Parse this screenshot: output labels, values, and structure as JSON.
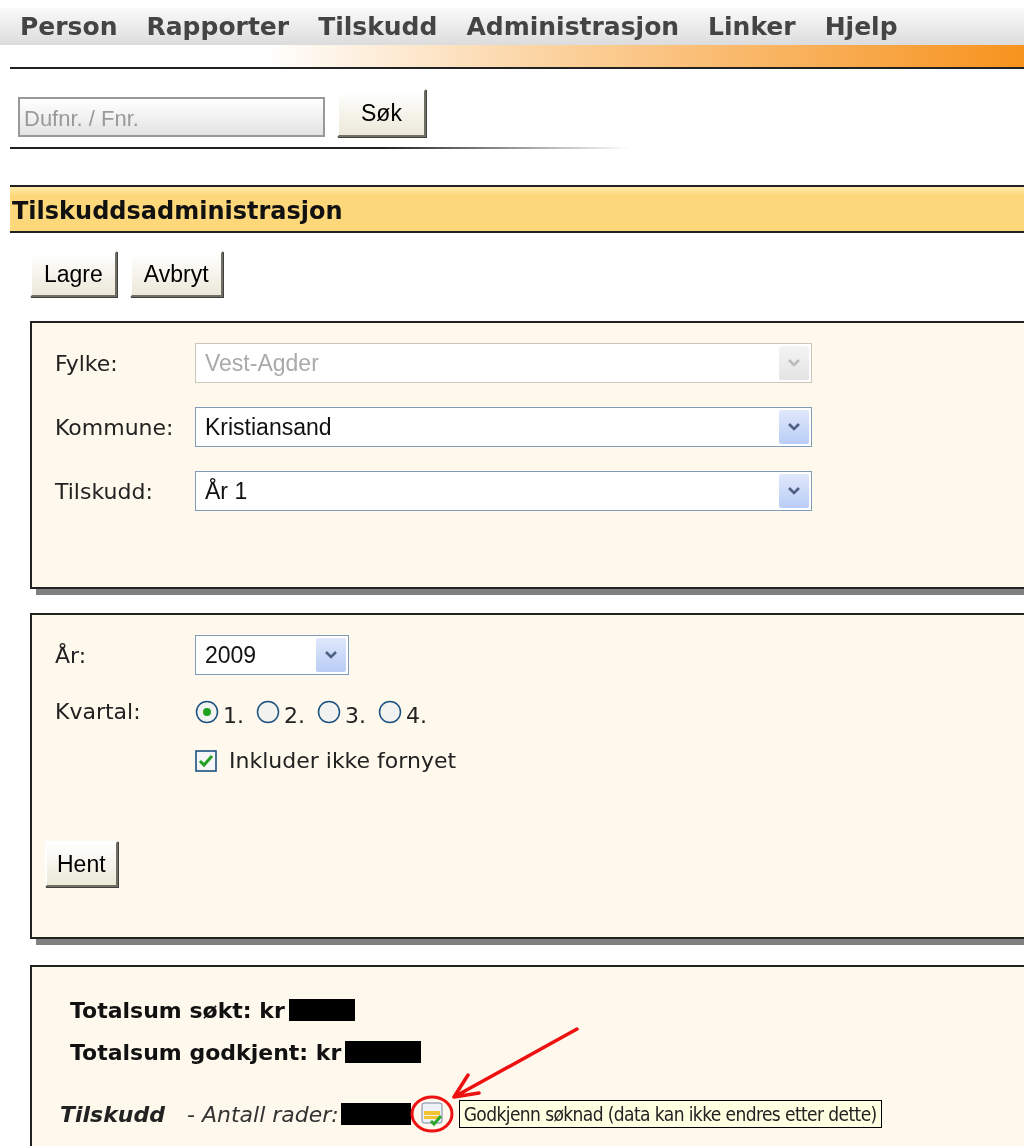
{
  "menu": [
    {
      "label": "Person"
    },
    {
      "label": "Rapporter"
    },
    {
      "label": "Tilskudd"
    },
    {
      "label": "Administrasjon"
    },
    {
      "label": "Linker"
    },
    {
      "label": "Hjelp"
    }
  ],
  "search": {
    "placeholder": "Dufnr. / Fnr.",
    "button": "Søk"
  },
  "section_title": "Tilskuddsadministrasjon",
  "actions": [
    "Lagre",
    "Avbryt"
  ],
  "selection": {
    "fields": [
      {
        "label": "Fylke:",
        "value": "Vest-Agder",
        "disabled": true
      },
      {
        "label": "Kommune:",
        "value": "Kristiansand",
        "disabled": false
      },
      {
        "label": "Tilskudd:",
        "value": "År 1",
        "disabled": false
      }
    ]
  },
  "period": {
    "year": {
      "label": "År:",
      "value": "2009"
    },
    "quarter": {
      "label": "Kvartal:",
      "options": [
        {
          "label": "1.",
          "selected": true
        },
        {
          "label": "2.",
          "selected": false
        },
        {
          "label": "3.",
          "selected": false
        },
        {
          "label": "4.",
          "selected": false
        }
      ]
    },
    "include_not_renewed": {
      "label": "Inkluder ikke fornyet",
      "checked": true
    },
    "fetch_button": "Hent"
  },
  "results": {
    "totals": [
      {
        "label": "Totalsum søkt: kr"
      },
      {
        "label": "Totalsum godkjent: kr"
      }
    ],
    "list_title": "Tilskudd",
    "row_count_label": "- Antall rader:",
    "tooltip": "Godkjenn søknad (data kan ikke endres etter dette)"
  }
}
